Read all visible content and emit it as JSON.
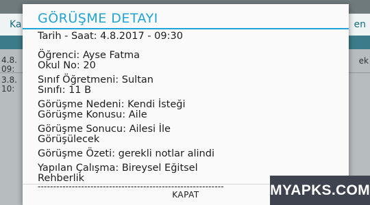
{
  "background": {
    "tab_left": "Ka",
    "tab_right": "en",
    "rows": [
      {
        "line1": "4.8.",
        "line2": "09:"
      },
      {
        "line1": "3.8.",
        "line2": "10:"
      }
    ],
    "row_right": "ek"
  },
  "dialog": {
    "title": "GÖRÜŞME DETAYI",
    "groups": [
      [
        "Tarih - Saat: 4.8.2017 - 09:30"
      ],
      [
        "Öğrenci: Ayse Fatma",
        "Okul No: 20"
      ],
      [
        "Sınıf Öğretmeni: Sultan",
        "Sınıfı: 11 B"
      ],
      [
        "Görüşme Nedeni: Kendi İsteği",
        "Görüşme Konusu: Aile"
      ],
      [
        "Görüşme Sonucu: Ailesi İle",
        "Görüşülecek"
      ],
      [
        "Görüşme Özeti: gerekli notlar alindi"
      ],
      [
        "Yapılan Çalışma: Bireysel Eğitsel",
        "Rehberlik"
      ]
    ],
    "separator": "------------------------------------------------------------",
    "close_label": "KAPAT"
  },
  "watermark": "MYAPKS.COM",
  "colors": {
    "accent": "#1fa3d8",
    "overlay": "#6f7a7d",
    "watermark_bg": "#3f4350"
  }
}
